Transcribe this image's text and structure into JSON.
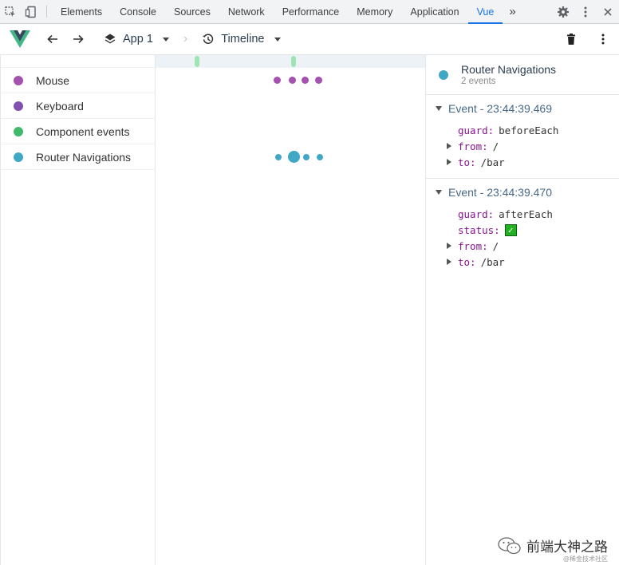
{
  "devtools": {
    "tabs": [
      "Elements",
      "Console",
      "Sources",
      "Network",
      "Performance",
      "Memory",
      "Application",
      "Vue"
    ],
    "active_tab": "Vue",
    "more_label": "»"
  },
  "toolbar": {
    "app_label": "App 1",
    "view_label": "Timeline"
  },
  "layers": [
    {
      "label": "Mouse",
      "color": "#a451af"
    },
    {
      "label": "Keyboard",
      "color": "#8151af"
    },
    {
      "label": "Component events",
      "color": "#41b86a"
    },
    {
      "label": "Router Navigations",
      "color": "#40a8c4"
    }
  ],
  "inspector": {
    "title": "Router Navigations",
    "subtitle": "2 events",
    "color": "#40a8c4",
    "events": [
      {
        "title": "Event - 23:44:39.469",
        "guard_key": "guard:",
        "guard_val": "beforeEach",
        "from_key": "from:",
        "from_val": "/",
        "to_key": "to:",
        "to_val": "/bar"
      },
      {
        "title": "Event - 23:44:39.470",
        "guard_key": "guard:",
        "guard_val": "afterEach",
        "status_key": "status:",
        "from_key": "from:",
        "from_val": "/",
        "to_key": "to:",
        "to_val": "/bar"
      }
    ]
  },
  "watermark": {
    "text": "前端大神之路",
    "sub": "@稀金技术社区"
  }
}
